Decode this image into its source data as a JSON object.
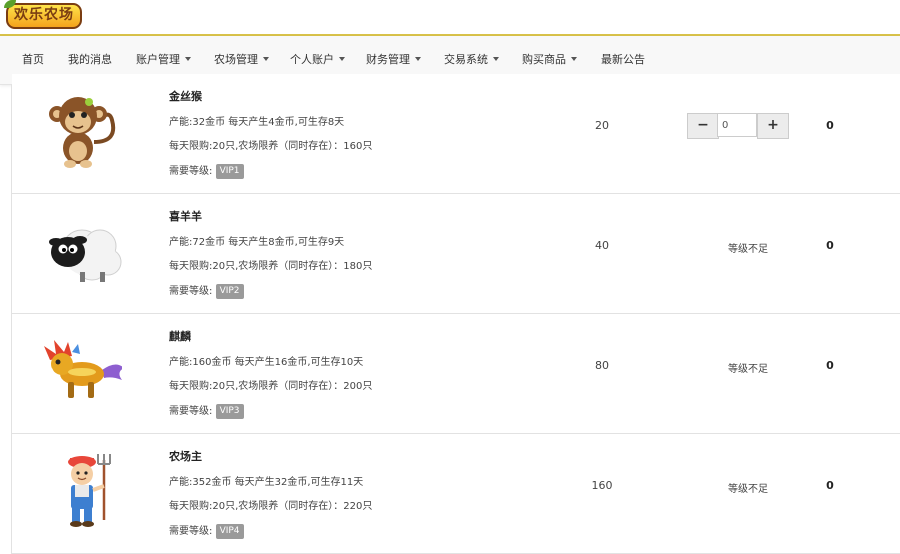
{
  "brand": {
    "logo_text": "欢乐农场"
  },
  "nav": {
    "items": [
      {
        "label": "首页",
        "dropdown": false
      },
      {
        "label": "我的消息",
        "dropdown": false
      },
      {
        "label": "账户管理",
        "dropdown": true
      },
      {
        "label": "农场管理",
        "dropdown": true
      },
      {
        "label": "个人账户",
        "dropdown": true
      },
      {
        "label": "财务管理",
        "dropdown": true
      },
      {
        "label": "交易系统",
        "dropdown": true
      },
      {
        "label": "购买商品",
        "dropdown": true
      },
      {
        "label": "最新公告",
        "dropdown": false
      }
    ]
  },
  "products": [
    {
      "name": "金丝猴",
      "icon": "monkey-icon",
      "production": "产能:32金币 每天产生4金币,可生存8天",
      "limit": "每天限购:20只,农场限养（同时存在）：160只",
      "level_label": "需要等级:",
      "vip": "VIP1",
      "price": "20",
      "stepper": {
        "minus": "−",
        "value": "0",
        "plus": "+"
      },
      "count": "0"
    },
    {
      "name": "喜羊羊",
      "icon": "sheep-icon",
      "production": "产能:72金币 每天产生8金币,可生存9天",
      "limit": "每天限购:20只,农场限养（同时存在）：180只",
      "level_label": "需要等级:",
      "vip": "VIP2",
      "price": "40",
      "status": "等级不足",
      "count": "0"
    },
    {
      "name": "麒麟",
      "icon": "qilin-icon",
      "production": "产能:160金币 每天产生16金币,可生存10天",
      "limit": "每天限购:20只,农场限养（同时存在）：200只",
      "level_label": "需要等级:",
      "vip": "VIP3",
      "price": "80",
      "status": "等级不足",
      "count": "0"
    },
    {
      "name": "农场主",
      "icon": "farmer-icon",
      "production": "产能:352金币 每天产生32金币,可生存11天",
      "limit": "每天限购:20只,农场限养（同时存在）：220只",
      "level_label": "需要等级:",
      "vip": "VIP4",
      "price": "160",
      "status": "等级不足",
      "count": "0"
    }
  ]
}
